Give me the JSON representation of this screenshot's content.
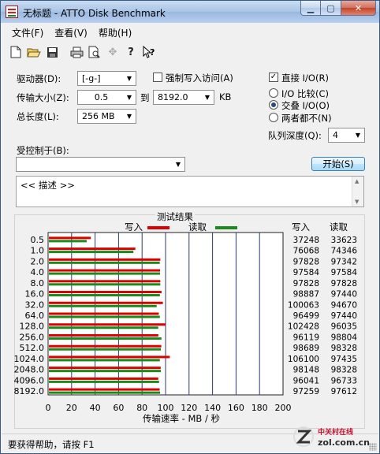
{
  "window": {
    "title": "无标题 - ATTO Disk Benchmark"
  },
  "menu": [
    "文件(F)",
    "查看(V)",
    "帮助(H)"
  ],
  "toolbar": {
    "icons": [
      "new-file-icon",
      "open-folder-icon",
      "save-icon",
      "print-icon",
      "print-preview-icon",
      "move-icon",
      "help-icon",
      "context-help-icon"
    ]
  },
  "form": {
    "drive_label": "驱动器(D):",
    "drive_value": "[-g-]",
    "force_write_label": "强制写入访问(A)",
    "force_write_checked": false,
    "direct_io_label": "直接 I/O(R)",
    "direct_io_checked": true,
    "transfer_label": "传输大小(Z):",
    "transfer_from": "0.5",
    "to_label": "到",
    "transfer_to": "8192.0",
    "kb_label": "KB",
    "total_label": "总长度(L):",
    "total_value": "256 MB",
    "io_compare_label": "I/O 比较(C)",
    "overlapped_io_label": "交叠 I/O(O)",
    "neither_label": "两者都不(N)",
    "selected_io_mode": "overlapped",
    "queue_label": "队列深度(Q):",
    "queue_value": "4",
    "controlled_label": "受控制于(B):",
    "controlled_value": "",
    "start_button": "开始(S)",
    "description": "<< 描述 >>"
  },
  "results": {
    "title": "测试结果",
    "write_col": "写入",
    "read_col": "读取"
  },
  "chart_data": {
    "type": "bar",
    "orientation": "horizontal",
    "categories": [
      "0.5",
      "1.0",
      "2.0",
      "4.0",
      "8.0",
      "16.0",
      "32.0",
      "64.0",
      "128.0",
      "256.0",
      "512.0",
      "1024.0",
      "2048.0",
      "4096.0",
      "8192.0"
    ],
    "series": [
      {
        "name": "写入",
        "color": "#dd0000",
        "values": [
          37248,
          76068,
          97828,
          97584,
          97828,
          98887,
          100063,
          96499,
          102428,
          96119,
          98689,
          106100,
          98148,
          96041,
          97259
        ]
      },
      {
        "name": "读取",
        "color": "#1a8a1a",
        "values": [
          33623,
          74346,
          97342,
          97584,
          97828,
          97440,
          94670,
          97440,
          96035,
          98804,
          98328,
          97435,
          98328,
          96733,
          97612
        ]
      }
    ],
    "xlabel": "传输速率 - MB / 秒",
    "xticks": [
      "0",
      "20",
      "40",
      "60",
      "80",
      "100",
      "120",
      "140",
      "160",
      "180",
      "200"
    ],
    "xlim": [
      0,
      200
    ],
    "legend": "top"
  },
  "status": {
    "text": "要获得帮助，请按 F1"
  },
  "watermark": {
    "brand": "中关村在线",
    "url": "zol.com.cn"
  }
}
